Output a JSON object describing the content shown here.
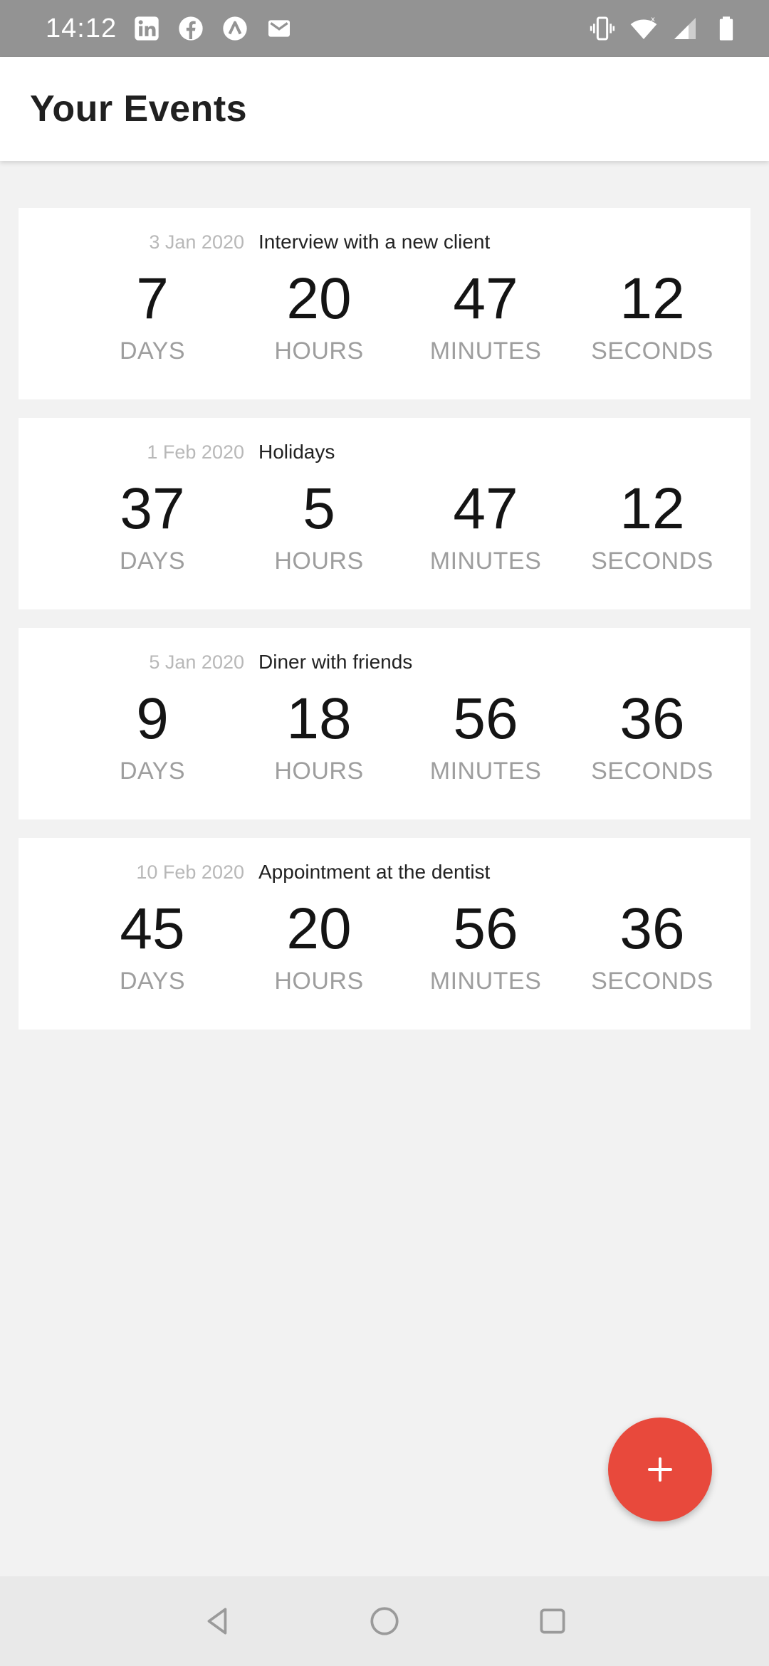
{
  "status_bar": {
    "time": "14:12",
    "left_icons": [
      "linkedin-icon",
      "facebook-icon",
      "arc-app-icon",
      "gmail-icon"
    ],
    "right_icons": [
      "vibrate-icon",
      "wifi-icon",
      "signal-icon",
      "battery-icon"
    ]
  },
  "header": {
    "title": "Your Events"
  },
  "events": [
    {
      "date": "3 Jan 2020",
      "name": "Interview with a new client",
      "countdown": [
        {
          "value": "7",
          "label": "DAYS"
        },
        {
          "value": "20",
          "label": "HOURS"
        },
        {
          "value": "47",
          "label": "MINUTES"
        },
        {
          "value": "12",
          "label": "SECONDS"
        }
      ]
    },
    {
      "date": "1 Feb 2020",
      "name": "Holidays",
      "countdown": [
        {
          "value": "37",
          "label": "DAYS"
        },
        {
          "value": "5",
          "label": "HOURS"
        },
        {
          "value": "47",
          "label": "MINUTES"
        },
        {
          "value": "12",
          "label": "SECONDS"
        }
      ]
    },
    {
      "date": "5 Jan 2020",
      "name": "Diner with friends",
      "countdown": [
        {
          "value": "9",
          "label": "DAYS"
        },
        {
          "value": "18",
          "label": "HOURS"
        },
        {
          "value": "56",
          "label": "MINUTES"
        },
        {
          "value": "36",
          "label": "SECONDS"
        }
      ]
    },
    {
      "date": "10 Feb 2020",
      "name": "Appointment at the dentist",
      "countdown": [
        {
          "value": "45",
          "label": "DAYS"
        },
        {
          "value": "20",
          "label": "HOURS"
        },
        {
          "value": "56",
          "label": "MINUTES"
        },
        {
          "value": "36",
          "label": "SECONDS"
        }
      ]
    }
  ],
  "fab": {
    "icon": "plus-icon",
    "color": "#e8493c"
  },
  "nav_bar": {
    "icons": [
      "back-icon",
      "home-icon",
      "recents-icon"
    ]
  },
  "colors": {
    "status_bar": "#939393",
    "background": "#f2f2f2",
    "card": "#ffffff",
    "accent": "#e8493c"
  }
}
